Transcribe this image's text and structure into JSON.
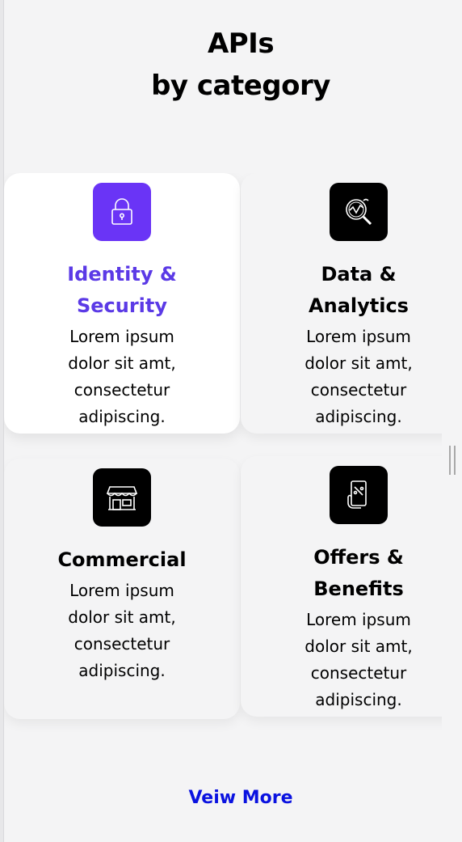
{
  "section": {
    "title_line1": "APIs",
    "title_line2": "by category"
  },
  "cards": [
    {
      "title": "Identity & Security",
      "body": "Lorem ipsum dolor sit amt, consectetur adipiscing.",
      "icon": "lock-icon",
      "state": "selected"
    },
    {
      "title": "Data & Analytics",
      "body": "Lorem ipsum dolor sit amt, consectetur adipiscing.",
      "icon": "analytics-search-icon"
    },
    {
      "title": "Commercial",
      "body": "Lorem ipsum dolor sit amt, consectetur adipiscing.",
      "icon": "storefront-icon"
    },
    {
      "title": "Offers & Benefits",
      "body": "Lorem ipsum dolor sit amt, consectetur adipiscing.",
      "icon": "phone-offer-icon"
    }
  ],
  "view_more_label": "Veiw More",
  "colors": {
    "accent": "#6a34f6",
    "accent_text": "#5b3ae6",
    "link": "#0a12e0",
    "background": "#f4f4f5"
  }
}
